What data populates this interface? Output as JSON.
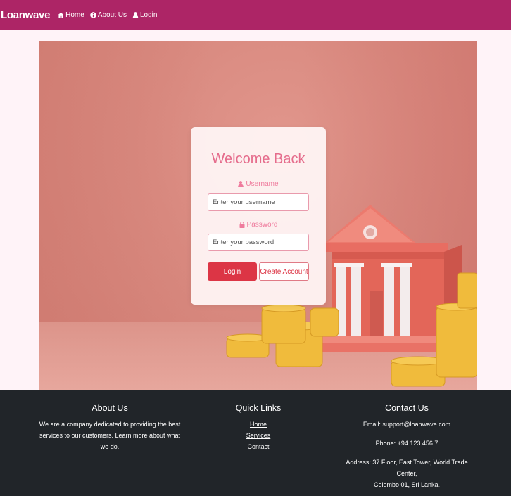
{
  "navbar": {
    "brand": "Loanwave",
    "links": [
      {
        "label": "Home",
        "icon": "home-icon"
      },
      {
        "label": "About Us",
        "icon": "info-icon"
      },
      {
        "label": "Login",
        "icon": "user-icon"
      }
    ]
  },
  "login": {
    "title": "Welcome Back",
    "username_label": "Username",
    "username_placeholder": "Enter your username",
    "username_value": "",
    "password_label": "Password",
    "password_placeholder": "Enter your password",
    "password_value": "",
    "login_button": "Login",
    "create_button": "Create Account"
  },
  "footer": {
    "about": {
      "title": "About Us",
      "text_line1": "We are a company dedicated to providing the best",
      "text_line2": "services to our customers. Learn more about what we do."
    },
    "quick_links": {
      "title": "Quick Links",
      "items": [
        "Home",
        "Services",
        "Contact"
      ]
    },
    "contact": {
      "title": "Contact Us",
      "email": "Email: support@loanwave.com",
      "phone": "Phone: +94 123 456 7",
      "address_line1": "Address: 37 Floor, East Tower, World Trade Center,",
      "address_line2": "Colombo 01, Sri Lanka."
    }
  },
  "colors": {
    "navbar": "#ad2566",
    "accent": "#dc3545",
    "title": "#e56c8c",
    "footer": "#212529"
  }
}
